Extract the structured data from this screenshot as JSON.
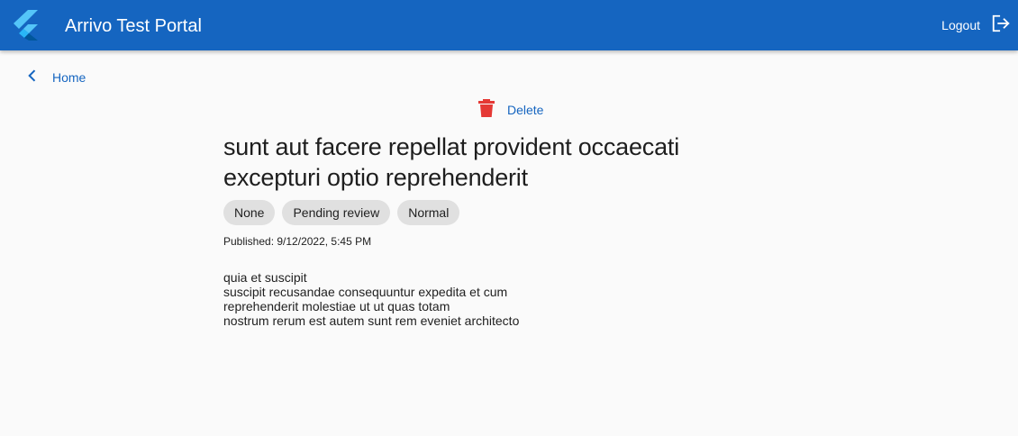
{
  "app": {
    "title": "Arrivo Test Portal",
    "logout_label": "Logout",
    "primary_color": "#1565c0"
  },
  "nav": {
    "back_label": "Home"
  },
  "actions": {
    "delete_label": "Delete",
    "delete_icon_color": "#e53935"
  },
  "post": {
    "title": "sunt aut facere repellat provident occaecati excepturi optio reprehenderit",
    "title_lines": [
      "sunt aut facere repellat provident occaecati",
      "excepturi optio reprehenderit"
    ],
    "chips": [
      "None",
      "Pending review",
      "Normal"
    ],
    "published": "Published: 9/12/2022, 5:45 PM",
    "body_lines": [
      "quia et suscipit",
      "suscipit recusandae consequuntur expedita et cum",
      "reprehenderit molestiae ut ut quas totam",
      "nostrum rerum est autem sunt rem eveniet architecto"
    ]
  },
  "icons": {
    "logo": "flutter-logo",
    "logout": "logout-icon",
    "back": "chevron-left-icon",
    "delete": "trash-icon"
  }
}
